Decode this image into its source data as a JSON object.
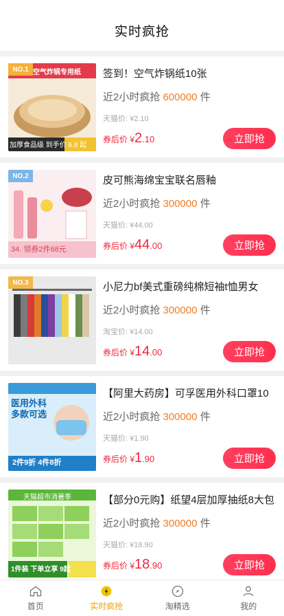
{
  "header": {
    "title": "实时疯抢"
  },
  "products": [
    {
      "rank": "NO.1",
      "rank_color": "#f5b13a",
      "name": "签到！空气炸锅纸10张",
      "sold_prefix": "近2小时疯抢",
      "sold_num": "600000",
      "sold_suffix": "件",
      "orig": "天猫价: ¥2.10",
      "after_label": "券后价 ¥",
      "price_int": "2",
      "price_dec": ".10",
      "buy": "立即抢",
      "img_text_a": "空气炸锅专用纸",
      "img_text_b": "加厚食品级 到手价 6.8 起"
    },
    {
      "rank": "NO.2",
      "rank_color": "#7ab6e8",
      "name": "皮可熊海绵宝宝联名唇釉",
      "sold_prefix": "近2小时疯抢",
      "sold_num": "300000",
      "sold_suffix": "件",
      "orig": "天猫价: ¥44.00",
      "after_label": "券后价 ¥",
      "price_int": "44",
      "price_dec": ".00",
      "buy": "立即抢",
      "img_text_a": "",
      "img_text_b": "34. 领券2件68元"
    },
    {
      "rank": "NO.3",
      "rank_color": "#f2b84b",
      "name": "小尼力bf美式重磅纯棉短袖t恤男女",
      "sold_prefix": "近2小时疯抢",
      "sold_num": "300000",
      "sold_suffix": "件",
      "orig": "淘宝价: ¥14.00",
      "after_label": "券后价 ¥",
      "price_int": "14",
      "price_dec": ".00",
      "buy": "立即抢",
      "img_text_a": "",
      "img_text_b": ""
    },
    {
      "rank": "",
      "rank_color": "",
      "name": "【阿里大药房】可孚医用外科口罩10",
      "sold_prefix": "近2小时疯抢",
      "sold_num": "300000",
      "sold_suffix": "件",
      "orig": "天猫价: ¥1.90",
      "after_label": "券后价 ¥",
      "price_int": "1",
      "price_dec": ".90",
      "buy": "立即抢",
      "img_text_a": "医用外科 多款可选",
      "img_text_b": "2件9折 4件8折"
    },
    {
      "rank": "",
      "rank_color": "",
      "name": "【部分0元购】纸望4层加厚抽纸8大包",
      "sold_prefix": "近2小时疯抢",
      "sold_num": "300000",
      "sold_suffix": "件",
      "orig": "天猫价: ¥18.90",
      "after_label": "券后价 ¥",
      "price_int": "18",
      "price_dec": ".90",
      "buy": "立即抢",
      "img_text_a": "天猫超市消暑季",
      "img_text_b": "1件装 下单立享 9起"
    }
  ],
  "tabs": [
    {
      "label": "首页",
      "icon": "home-icon"
    },
    {
      "label": "实时疯抢",
      "icon": "flash-icon"
    },
    {
      "label": "淘精选",
      "icon": "compass-icon"
    },
    {
      "label": "我的",
      "icon": "user-icon"
    }
  ],
  "colors": {
    "accent": "#ff2f4d",
    "tab_active": "#f0a000",
    "sold_num": "#f47a1f"
  }
}
